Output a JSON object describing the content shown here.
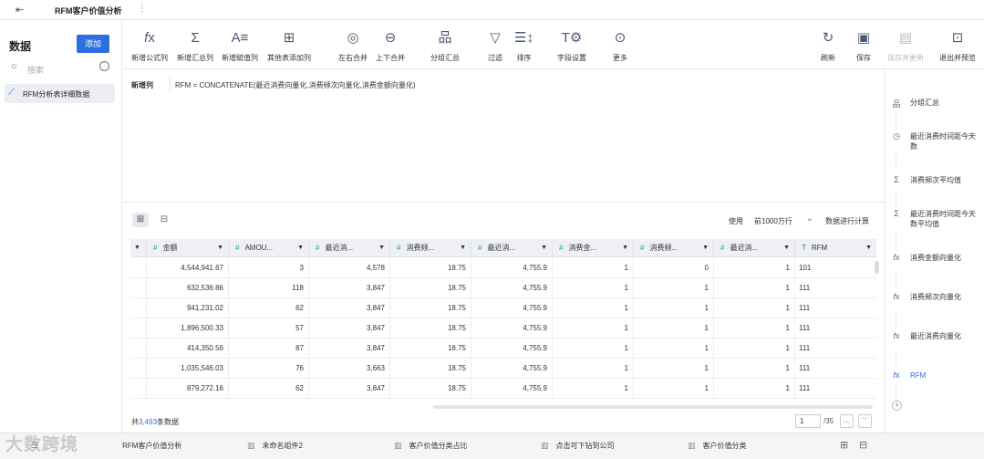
{
  "header": {
    "back_icon": "back-icon",
    "title": "RFM客户价值分析"
  },
  "left": {
    "heading": "数据",
    "add_label": "添加",
    "search_placeholder": "搜索",
    "dataset": "RFM分析表详细数据"
  },
  "toolbar": {
    "items": [
      {
        "label": "新增公式列",
        "icon": "fx-icon"
      },
      {
        "label": "新增汇总列",
        "icon": "sigma-icon"
      },
      {
        "label": "新增赋值列",
        "icon": "assign-icon"
      },
      {
        "label": "其他表添加列",
        "icon": "add-column-icon"
      },
      {
        "label": "左右合并",
        "icon": "merge-horizontal-icon"
      },
      {
        "label": "上下合并",
        "icon": "merge-vertical-icon"
      },
      {
        "label": "分组汇总",
        "icon": "group-icon"
      },
      {
        "label": "过滤",
        "icon": "filter-icon"
      },
      {
        "label": "排序",
        "icon": "sort-icon"
      },
      {
        "label": "字段设置",
        "icon": "field-settings-icon"
      },
      {
        "label": "更多",
        "icon": "more-icon"
      }
    ],
    "right_items": [
      {
        "label": "刷新",
        "icon": "refresh-icon"
      },
      {
        "label": "保存",
        "icon": "save-icon"
      },
      {
        "label": "保存并更新",
        "icon": "save-update-icon"
      },
      {
        "label": "退出并预览",
        "icon": "exit-preview-icon"
      }
    ]
  },
  "formula": {
    "label": "新增列",
    "expression": "RFM = CONCATENATE(最近消费向量化,消费频次向量化,消费金额向量化)"
  },
  "table_bar": {
    "use_label": "使用",
    "rows_option": "前1000万行",
    "calc_label": "数据进行计算"
  },
  "table": {
    "columns": [
      "金额",
      "AMOU...",
      "最近消...",
      "消费频...",
      "最近消...",
      "消费金...",
      "消费频...",
      "最近消...",
      "RFM"
    ],
    "rows": [
      [
        "4,544,941.67",
        "3",
        "4,578",
        "18.75",
        "4,755.9",
        "1",
        "0",
        "1",
        "101"
      ],
      [
        "632,536.86",
        "118",
        "3,847",
        "18.75",
        "4,755.9",
        "1",
        "1",
        "1",
        "111"
      ],
      [
        "941,231.02",
        "62",
        "3,847",
        "18.75",
        "4,755.9",
        "1",
        "1",
        "1",
        "111"
      ],
      [
        "1,896,500.33",
        "57",
        "3,847",
        "18.75",
        "4,755.9",
        "1",
        "1",
        "1",
        "111"
      ],
      [
        "414,350.56",
        "87",
        "3,847",
        "18.75",
        "4,755.9",
        "1",
        "1",
        "1",
        "111"
      ],
      [
        "1,035,546.03",
        "76",
        "3,663",
        "18.75",
        "4,755.9",
        "1",
        "1",
        "1",
        "111"
      ],
      [
        "879,272.16",
        "62",
        "3,847",
        "18.75",
        "4,755.9",
        "1",
        "1",
        "1",
        "111"
      ]
    ]
  },
  "footer": {
    "count_prefix": "共",
    "count": "3,493",
    "count_suffix": "条数据",
    "page": "1",
    "total_pages": "/35"
  },
  "right_panel": {
    "items": [
      {
        "label": "分组汇总",
        "icon": "group-icon"
      },
      {
        "label": "最近消费时间距今天数",
        "icon": "clock-icon"
      },
      {
        "label": "消费频次平均值",
        "icon": "sigma-icon"
      },
      {
        "label": "最近消费时间距今天数平均值",
        "icon": "sigma-icon"
      },
      {
        "label": "消费金额向量化",
        "icon": "fx-icon"
      },
      {
        "label": "消费频次向量化",
        "icon": "fx-icon"
      },
      {
        "label": "最近消费向量化",
        "icon": "fx-icon"
      },
      {
        "label": "RFM",
        "icon": "fx-icon"
      }
    ]
  },
  "bottom_tabs": [
    {
      "label": "RFM客户价值分析"
    },
    {
      "label": "未命名组件2"
    },
    {
      "label": "客户价值分类占比"
    },
    {
      "label": "点击可下钻到公司"
    },
    {
      "label": "客户价值分类"
    }
  ],
  "watermark": "大数跨境",
  "colors": {
    "accent": "#2d6ee0",
    "number_type": "#2a9d8f"
  }
}
